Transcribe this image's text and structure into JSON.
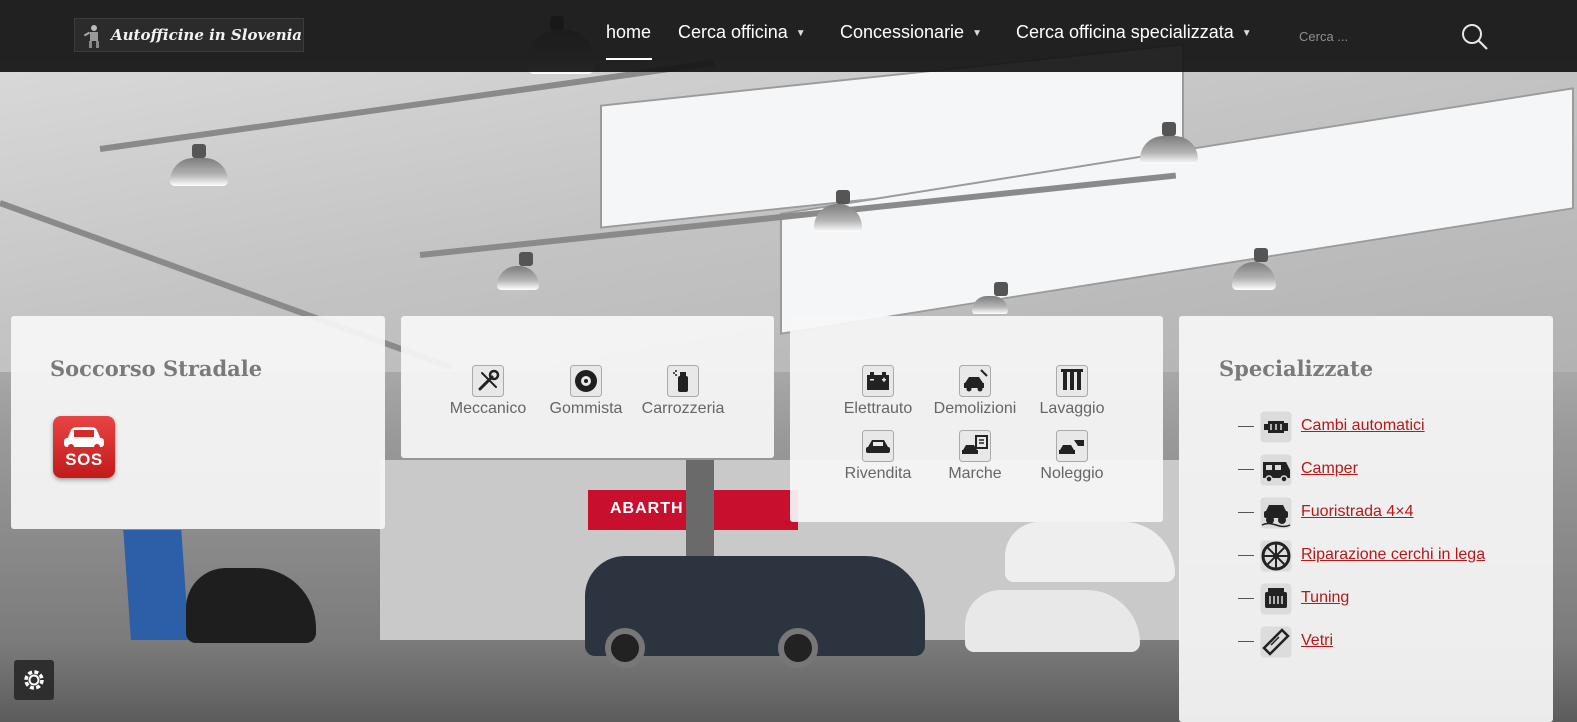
{
  "header": {
    "logo_text": "Autofficine in Slovenia",
    "nav": [
      {
        "label": "home"
      },
      {
        "label": "Cerca officina"
      },
      {
        "label": "Concessionarie"
      },
      {
        "label": "Cerca officina specializzata"
      }
    ],
    "search_placeholder": "Cerca ..."
  },
  "soccorso": {
    "title": "Soccorso Stradale",
    "badge_label": "SOS"
  },
  "services_a": [
    {
      "label": "Meccanico",
      "icon": "wrench-screwdriver-icon"
    },
    {
      "label": "Gommista",
      "icon": "tire-icon"
    },
    {
      "label": "Carrozzeria",
      "icon": "spray-can-icon"
    }
  ],
  "services_b": [
    {
      "label": "Elettrauto",
      "icon": "battery-icon"
    },
    {
      "label": "Demolizioni",
      "icon": "car-crusher-icon"
    },
    {
      "label": "Lavaggio",
      "icon": "car-wash-icon"
    },
    {
      "label": "Rivendita",
      "icon": "car-icon"
    },
    {
      "label": "Marche",
      "icon": "car-brand-icon"
    },
    {
      "label": "Noleggio",
      "icon": "car-rental-icon"
    }
  ],
  "specializzate": {
    "title": "Specializzate",
    "items": [
      {
        "label": "Cambi automatici",
        "icon": "gearbox-icon"
      },
      {
        "label": "Camper",
        "icon": "camper-icon"
      },
      {
        "label": "Fuoristrada 4×4",
        "icon": "offroad-car-icon"
      },
      {
        "label": "Riparazione cerchi in lega",
        "icon": "alloy-wheel-icon"
      },
      {
        "label": "Tuning",
        "icon": "tuning-engine-icon"
      },
      {
        "label": "Vetri",
        "icon": "windshield-icon"
      }
    ]
  },
  "colors": {
    "topbar": "#141414",
    "link_red": "#b81818",
    "sos_red": "#d42a2a",
    "card_bg": "#f6f6f6"
  }
}
